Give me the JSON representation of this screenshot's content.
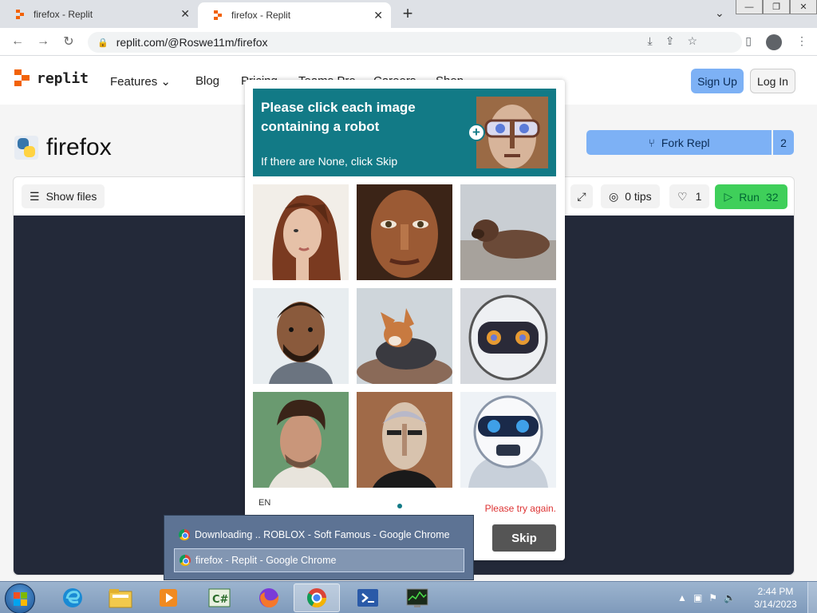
{
  "browser": {
    "tabs": [
      {
        "title": "firefox - Replit",
        "close": "✕"
      },
      {
        "title": "firefox - Replit",
        "close": "✕"
      }
    ],
    "new_tab": "+",
    "url": "replit.com/@Roswe11m/firefox"
  },
  "replit": {
    "logo_text": "replit",
    "nav": [
      "Features",
      "Blog",
      "Pricing",
      "Teams Pro",
      "Careers",
      "Shop"
    ],
    "sign_up": "Sign Up",
    "log_in": "Log In",
    "repl_name": "firefox",
    "fork_label": "Fork Repl",
    "fork_count": "2",
    "show_files": "Show files",
    "tips": "0 tips",
    "likes": "1",
    "run_label": "Run",
    "run_count": "32",
    "colors": {
      "primary_button": "#7db1f5",
      "run_button": "#3fcf5a",
      "console_bg": "#232939",
      "logo_orange": "#f26207"
    }
  },
  "captcha": {
    "prompt": "Please click each image containing a robot",
    "hint": "If there are None, click Skip",
    "images": [
      "woman-portrait-icon",
      "bronze-face-icon",
      "dog-lying-icon",
      "man-beard-icon",
      "corgi-icon",
      "robot-face-icon",
      "man-curly-hair-icon",
      "android-face-icon",
      "white-robot-icon"
    ],
    "language": "EN",
    "error": "Please try again.",
    "skip_label": "Skip",
    "accent_color": "#127a86"
  },
  "taskbar_popup": {
    "items": [
      "Downloading .. ROBLOX - Soft Famous - Google Chrome",
      "firefox - Replit - Google Chrome"
    ]
  },
  "taskbar": {
    "apps": [
      "internet-explorer-icon",
      "edge-icon",
      "file-explorer-icon",
      "media-player-icon",
      "csharp-icon",
      "firefox-icon",
      "chrome-icon",
      "powershell-icon",
      "task-manager-icon"
    ],
    "time": "2:44 PM",
    "date": "3/14/2023"
  }
}
